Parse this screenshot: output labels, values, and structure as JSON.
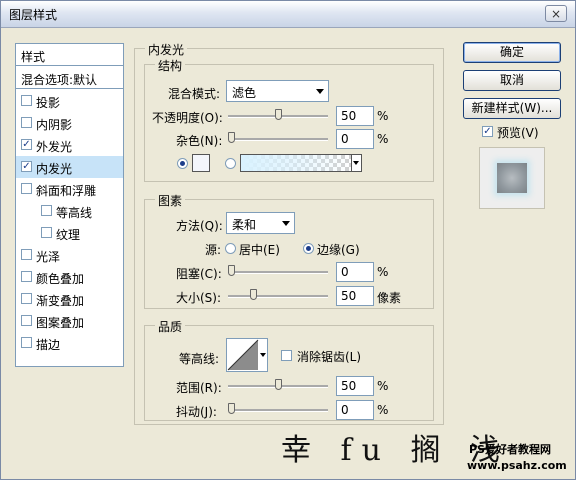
{
  "dialog": {
    "title": "图层样式",
    "close_glyph": "×"
  },
  "styles_list": {
    "header": "样式",
    "blend_options": "混合选项:默认",
    "items": [
      {
        "label": "投影",
        "checked": false
      },
      {
        "label": "内阴影",
        "checked": false
      },
      {
        "label": "外发光",
        "checked": true
      },
      {
        "label": "内发光",
        "checked": true,
        "selected": true
      },
      {
        "label": "斜面和浮雕",
        "checked": false
      },
      {
        "label": "等高线",
        "checked": false
      },
      {
        "label": "纹理",
        "checked": false
      },
      {
        "label": "光泽",
        "checked": false
      },
      {
        "label": "颜色叠加",
        "checked": false
      },
      {
        "label": "渐变叠加",
        "checked": false
      },
      {
        "label": "图案叠加",
        "checked": false
      },
      {
        "label": "描边",
        "checked": false
      }
    ]
  },
  "panel": {
    "title": "内发光",
    "structure": {
      "title": "结构",
      "blend_mode_label": "混合模式:",
      "blend_mode_value": "滤色",
      "opacity_label": "不透明度(O):",
      "opacity_value": "50",
      "noise_label": "杂色(N):",
      "noise_value": "0",
      "percent": "%"
    },
    "elements": {
      "title": "图素",
      "technique_label": "方法(Q):",
      "technique_value": "柔和",
      "source_label": "源:",
      "source_center": "居中(E)",
      "source_edge": "边缘(G)",
      "choke_label": "阻塞(C):",
      "choke_value": "0",
      "size_label": "大小(S):",
      "size_value": "50",
      "size_unit": "像素",
      "percent": "%"
    },
    "quality": {
      "title": "品质",
      "contour_label": "等高线:",
      "antialias_label": "消除锯齿(L)",
      "range_label": "范围(R):",
      "range_value": "50",
      "jitter_label": "抖动(J):",
      "jitter_value": "0",
      "percent": "%"
    }
  },
  "buttons": {
    "ok": "确定",
    "cancel": "取消",
    "new_style": "新建样式(W)...",
    "preview": "预览(V)"
  },
  "watermark": {
    "handwriting": "幸 fu 搁 浅",
    "site_name": "PS爱好者教程网",
    "site_url": "www.psahz.com"
  }
}
